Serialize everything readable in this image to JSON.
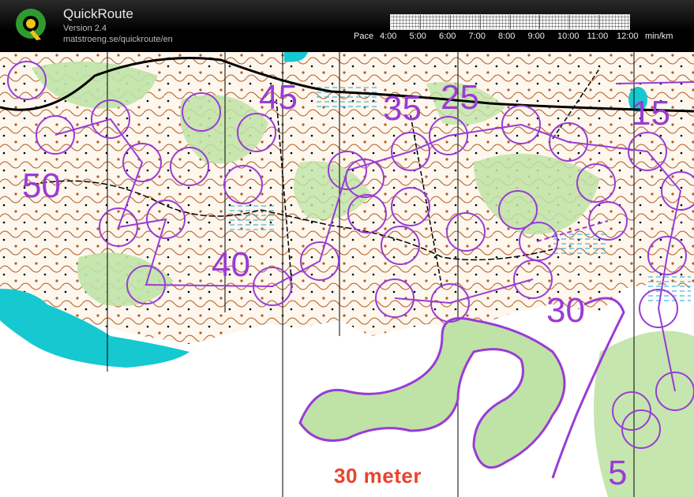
{
  "app": {
    "title": "QuickRoute",
    "version": "Version 2.4",
    "url": "matstroeng.se/quickroute/en"
  },
  "pace_scale": {
    "label": "Pace",
    "ticks": [
      "4:00",
      "5:00",
      "6:00",
      "7:00",
      "8:00",
      "9:00",
      "10:00",
      "11:00",
      "12:00"
    ],
    "unit": "min/km"
  },
  "map": {
    "control_numbers": [
      "45",
      "35",
      "25",
      "15",
      "50",
      "40",
      "30",
      "5"
    ],
    "scale_label": "30 meter"
  },
  "colors": {
    "route_purple": "#9a3bd6",
    "forest_green": "#bfe3a6",
    "water_cyan": "#16c8d0",
    "contour_brown": "#b45a1e"
  }
}
